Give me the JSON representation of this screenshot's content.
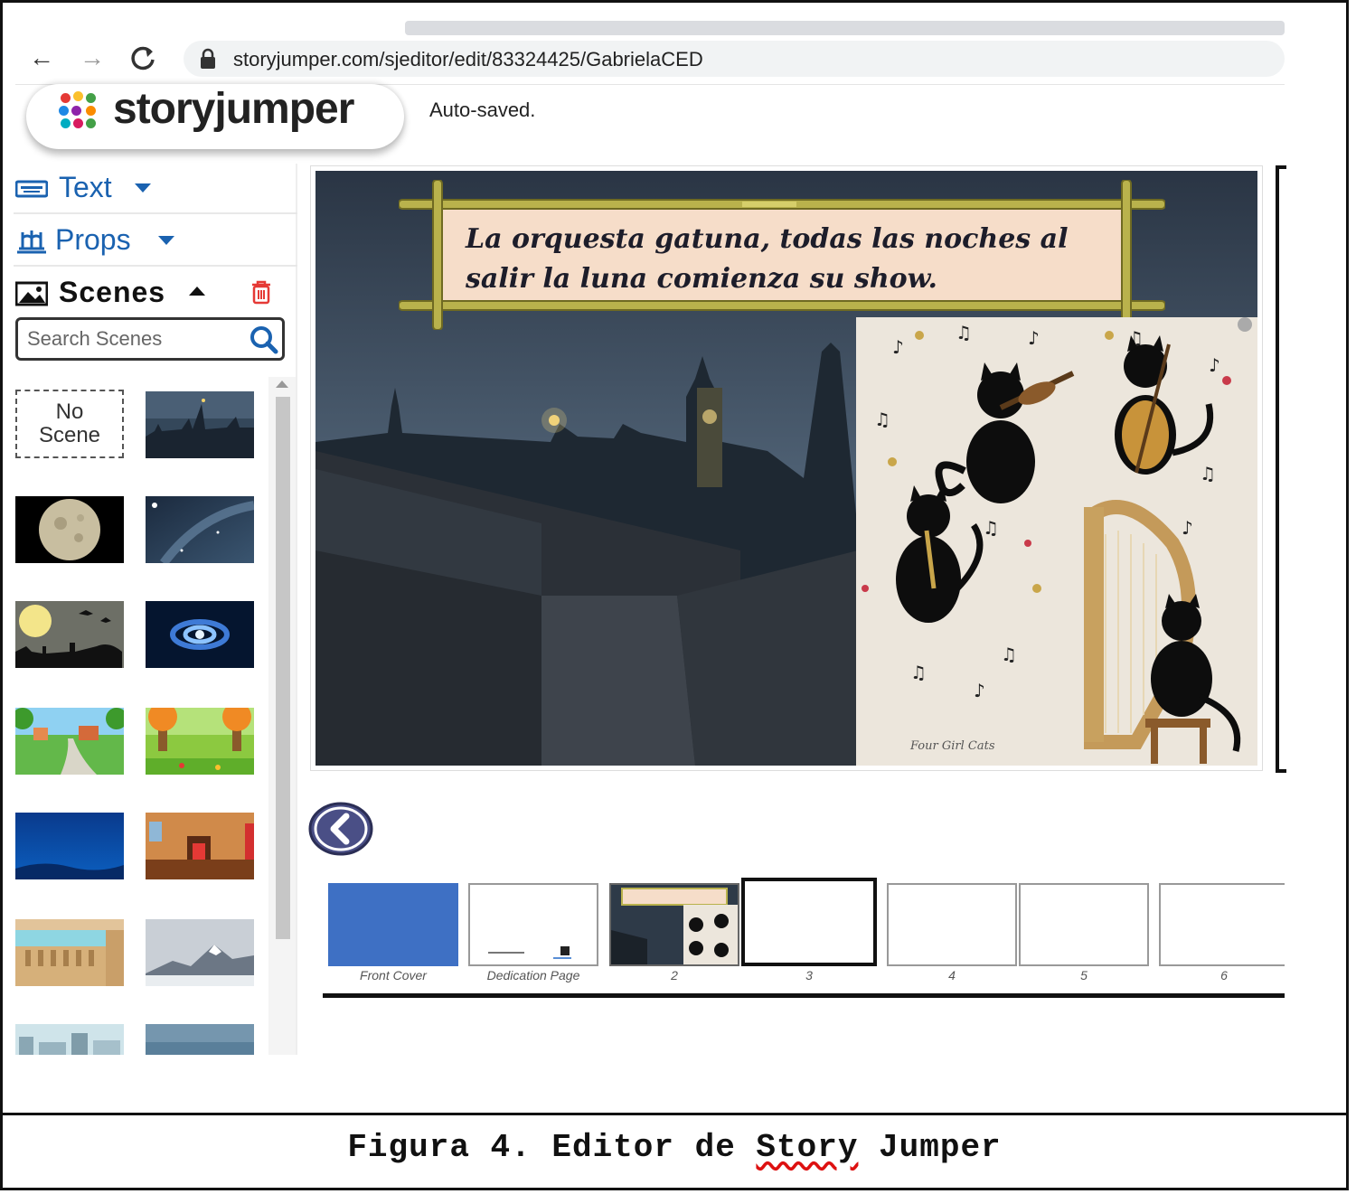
{
  "browser": {
    "url": "storyjumper.com/sjeditor/edit/83324425/GabrielaCED",
    "back_glyph": "←",
    "forward_glyph": "→",
    "reload_glyph": "C"
  },
  "app": {
    "logo_text": "storyjumper",
    "status": "Auto-saved.",
    "brand_colors": [
      "#e53935",
      "#fbc02d",
      "#43a047",
      "#1e88e5",
      "#8e24aa",
      "#fb8c00",
      "#00acc1",
      "#d81b60"
    ]
  },
  "sidebar": {
    "text_label": "Text",
    "props_label": "Props",
    "scenes_label": "Scenes",
    "search_placeholder": "Search Scenes",
    "no_scene_line1": "No",
    "no_scene_line2": "Scene",
    "scenes": [
      {
        "name": "city-night"
      },
      {
        "name": "full-moon"
      },
      {
        "name": "starry-night"
      },
      {
        "name": "graveyard-moon"
      },
      {
        "name": "galaxy-swirl"
      },
      {
        "name": "village-path"
      },
      {
        "name": "forest-meadow"
      },
      {
        "name": "underwater"
      },
      {
        "name": "living-room"
      },
      {
        "name": "balcony"
      },
      {
        "name": "snowy-mountain"
      },
      {
        "name": "city-buildings"
      },
      {
        "name": "dusk-sky"
      }
    ]
  },
  "editor": {
    "sign_text": "La orquesta gatuna, todas las noches al salir la luna comienza su show.",
    "image_signature": "Four Girl Cats"
  },
  "pages": [
    {
      "label": "Front Cover"
    },
    {
      "label": "Dedication Page"
    },
    {
      "label": "2"
    },
    {
      "label": "3",
      "active": true
    },
    {
      "label": "4"
    },
    {
      "label": "5"
    },
    {
      "label": "6"
    }
  ],
  "caption": {
    "prefix": "Figura 4. Editor de ",
    "story": "Story",
    "suffix": " Jumper"
  },
  "colors": {
    "link_blue": "#1a62b0",
    "trash_red": "#e53935",
    "cover_blue": "#3e70c4",
    "back_button": "#4a4f86"
  }
}
